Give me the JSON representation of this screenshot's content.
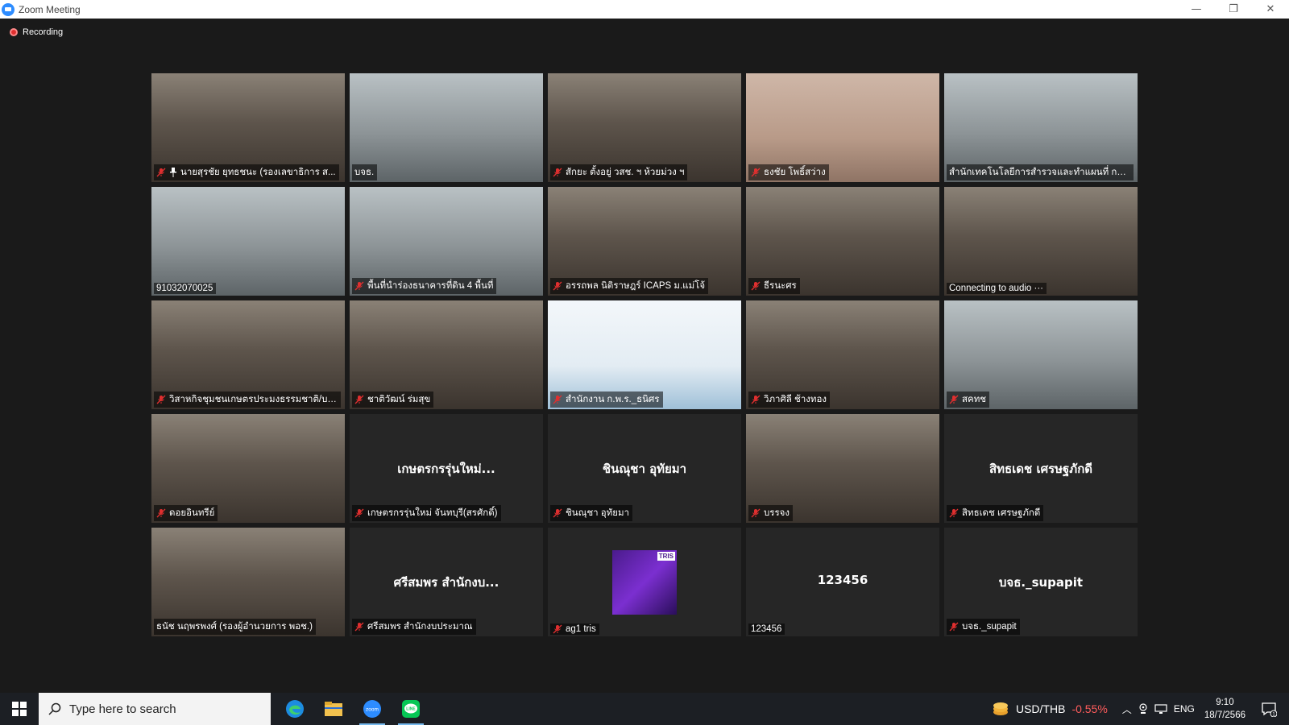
{
  "window": {
    "title": "Zoom Meeting",
    "minimize": "—",
    "maximize": "❐",
    "close": "✕"
  },
  "recording": {
    "label": "Recording"
  },
  "tiles": [
    {
      "name": "นายสุรชัย ยุทธชนะ (รองเลขาธิการ ส...",
      "muted": true,
      "pinned": true,
      "video": "person"
    },
    {
      "name": "บจธ.",
      "muted": false,
      "active": true,
      "video": "room"
    },
    {
      "name": "สักยะ ตั้งอยู่ วสช. ฯ ห้วยม่วง ฯ",
      "muted": true,
      "video": "person"
    },
    {
      "name": "ธงชัย โพธิ์สว่าง",
      "muted": true,
      "video": "hand"
    },
    {
      "name": "สำนักเทคโนโลยีการสำรวจและทำแผนที่ กรมพั...",
      "muted": false,
      "video": "room"
    },
    {
      "name": "91032070025",
      "muted": false,
      "video": "room"
    },
    {
      "name": "พื้นที่นำร่องธนาคารที่ดิน 4 พื้นที่",
      "muted": true,
      "video": "room"
    },
    {
      "name": "อรรถพล นิติราษฎร์ ICAPS ม.แม่โจ้",
      "muted": true,
      "video": "person"
    },
    {
      "name": "ธีรนะศร",
      "muted": true,
      "video": "person"
    },
    {
      "name": "Connecting to audio ···",
      "muted": false,
      "video": "person"
    },
    {
      "name": "วิสาหกิจชุมชนเกษตรประมงธรรมชาติ/บาง...",
      "muted": true,
      "video": "person"
    },
    {
      "name": "ชาติวัฒน์ ร่มสุข",
      "muted": true,
      "video": "person"
    },
    {
      "name": "สำนักงาน ก.พ.ร._ธนิศร",
      "muted": true,
      "video": "banner"
    },
    {
      "name": "วิภาศิลี ช้างทอง",
      "muted": true,
      "video": "person"
    },
    {
      "name": "สคทช",
      "muted": true,
      "video": "room"
    },
    {
      "name": "ดอยอินทรีย์",
      "muted": true,
      "video": "person"
    },
    {
      "name": "เกษตรกรรุ่นใหม่ จันทบุรี(สรศักดิ์)",
      "muted": true,
      "video": "none",
      "display_name": "เกษตรกรรุ่นใหม่..."
    },
    {
      "name": "ชินณุชา อุทัยมา",
      "muted": true,
      "video": "none",
      "display_name": "ชินณุชา อุทัยมา"
    },
    {
      "name": "บรรจง",
      "muted": true,
      "video": "person"
    },
    {
      "name": "สิทธเดช เศรษฐภักดี",
      "muted": true,
      "video": "none",
      "display_name": "สิทธเดช เศรษฐภักดี"
    },
    {
      "name": "ธนัช นฤพรพงศ์ (รองผู้อำนวยการ พอช.)",
      "muted": false,
      "video": "person"
    },
    {
      "name": "ศรีสมพร สำนักงบประมาณ",
      "muted": true,
      "video": "none",
      "display_name": "ศรีสมพร สำนักงบ..."
    },
    {
      "name": "ag1 tris",
      "muted": true,
      "video": "logo",
      "logo_text": "TRIS"
    },
    {
      "name": "123456",
      "muted": false,
      "video": "none",
      "display_name": "123456"
    },
    {
      "name": "บจธ._supapit",
      "muted": true,
      "video": "none",
      "display_name": "บจธ._supapit"
    }
  ],
  "taskbar": {
    "search_placeholder": "Type here to search",
    "apps": [
      "edge-icon",
      "file-explorer-icon",
      "zoom-icon",
      "line-icon"
    ],
    "fx_pair": "USD/THB",
    "fx_change": "-0.55%",
    "language": "ENG",
    "time": "9:10",
    "date": "18/7/2566",
    "notification_count": "1"
  },
  "colors": {
    "active_border": "#d7e33a",
    "mute": "#e02f2f",
    "accent": "#2d8cff"
  }
}
